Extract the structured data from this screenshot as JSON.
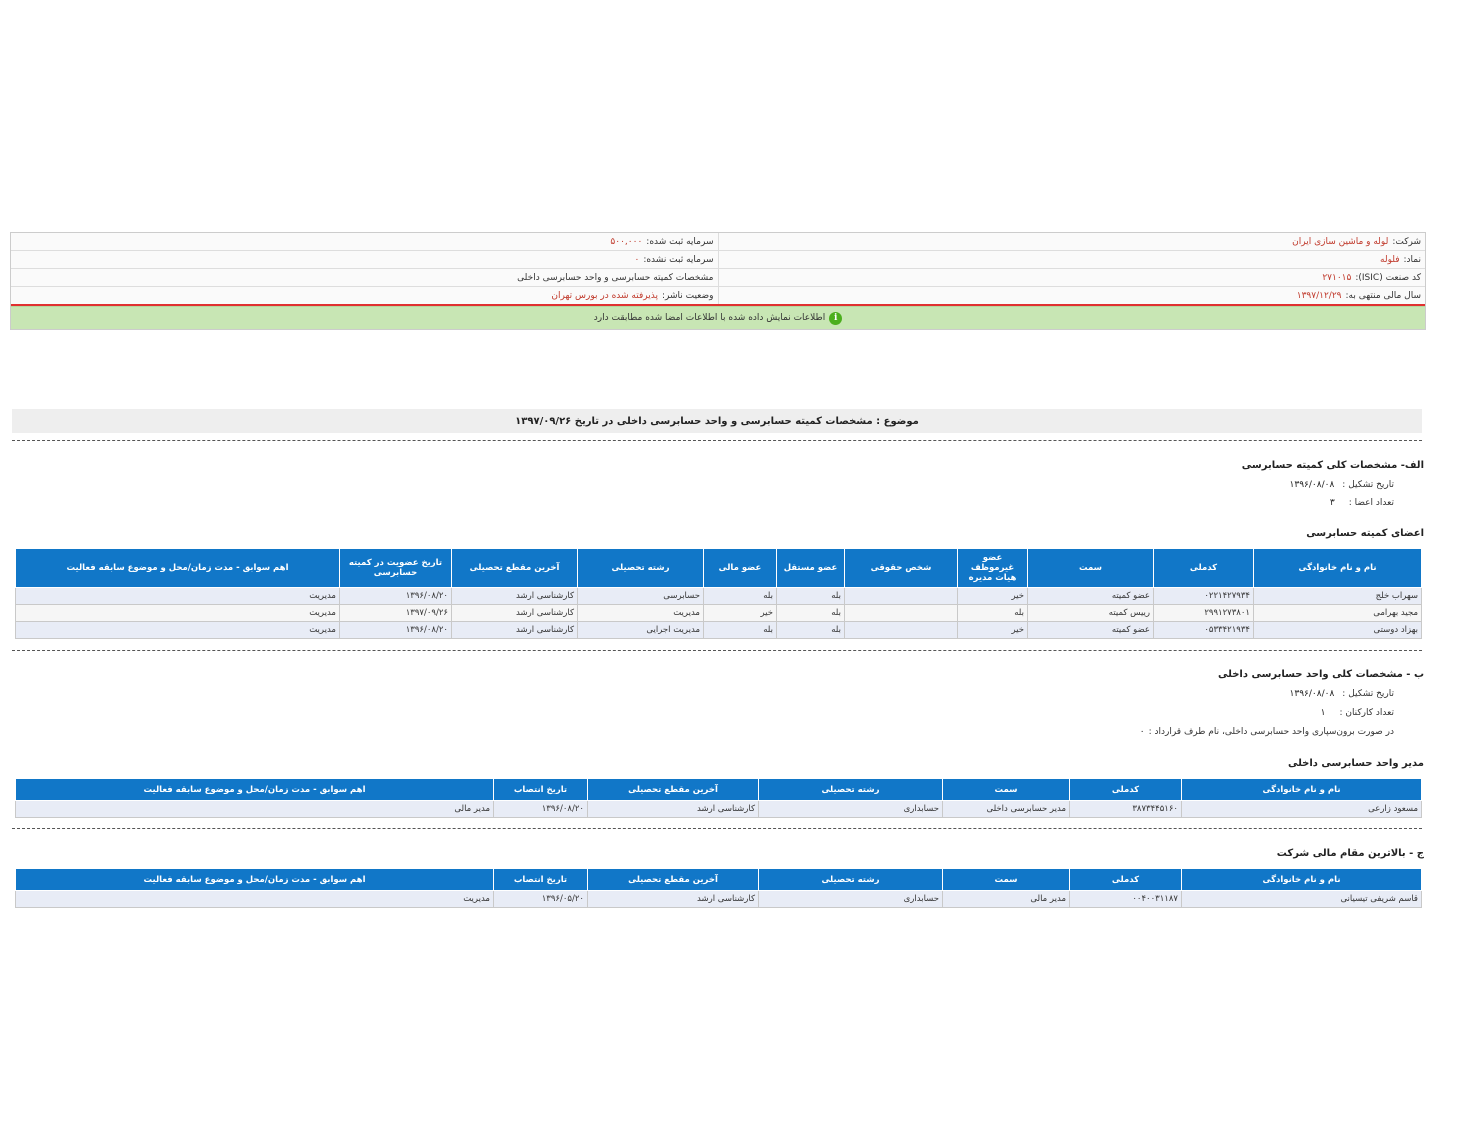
{
  "info": {
    "company_label": "شرکت:",
    "company_value": "لوله و ماشین سازی ایران",
    "symbol_label": "نماد:",
    "symbol_value": "فلوله",
    "isic_label": "کد صنعت (ISIC):",
    "isic_value": "۲۷۱۰۱۵",
    "fiscal_label": "سال مالی منتهی به:",
    "fiscal_value": "۱۳۹۷/۱۲/۲۹",
    "reg_capital_label": "سرمایه ثبت شده:",
    "reg_capital_value": "۵۰۰,۰۰۰",
    "unreg_capital_label": "سرمایه ثبت نشده:",
    "unreg_capital_value": "۰",
    "report_title": "مشخصات کمیته حسابرسی و واحد حسابرسی داخلی",
    "status_label": "وضعیت ناشر:",
    "status_value": "پذیرفته شده در بورس تهران",
    "notice": "اطلاعات نمایش داده شده با اطلاعات امضا شده مطابقت دارد",
    "notice_icon": "i"
  },
  "subject": "موضوع : مشخصات کمیته حسابرسی و واحد حسابرسی داخلی در تاریخ ۱۳۹۷/۰۹/۲۶",
  "section_a": {
    "title": "الف- مشخصات کلی کمیته حسابرسی",
    "formation_label": "تاریخ تشکیل :",
    "formation_value": "۱۳۹۶/۰۸/۰۸",
    "members_label": "تعداد اعضا :",
    "members_value": "۳"
  },
  "committee": {
    "title": "اعضای کمیته حسابرسی",
    "headers": [
      "نام و نام خانوادگی",
      "کدملی",
      "سمت",
      "عضو غیرموظف هیات مدیره",
      "شخص حقوقی",
      "عضو مستقل",
      "عضو مالی",
      "رشته تحصیلی",
      "آخرین مقطع تحصیلی",
      "تاریخ عضویت در کمیته حسابرسی",
      "اهم سوابق - مدت زمان/محل و موضوع سابقه فعالیت"
    ],
    "rows": [
      [
        "سهراب خلج",
        "۰۲۲۱۴۲۷۹۳۴",
        "عضو کمیته",
        "خیر",
        "",
        "بله",
        "بله",
        "حسابرسی",
        "کارشناسی ارشد",
        "۱۳۹۶/۰۸/۲۰",
        "مدیریت"
      ],
      [
        "مجید بهرامی",
        "۲۹۹۱۲۷۳۸۰۱",
        "رییس کمیته",
        "بله",
        "",
        "بله",
        "خیر",
        "مدیریت",
        "کارشناسی ارشد",
        "۱۳۹۷/۰۹/۲۶",
        "مدیریت"
      ],
      [
        "بهزاد دوستی",
        "۰۵۳۳۴۲۱۹۳۴",
        "عضو کمیته",
        "خیر",
        "",
        "بله",
        "بله",
        "مدیریت اجرایی",
        "کارشناسی ارشد",
        "۱۳۹۶/۰۸/۲۰",
        "مدیریت"
      ]
    ]
  },
  "section_b": {
    "title": "ب - مشخصات کلی واحد حسابرسی داخلی",
    "formation_label": "تاریخ تشکیل :",
    "formation_value": "۱۳۹۶/۰۸/۰۸",
    "staff_label": "تعداد کارکنان :",
    "staff_value": "۱",
    "outsource_label": "در صورت برون‌سپاری واحد حسابرسی داخلی، نام طرف قرارداد :",
    "outsource_value": "۰"
  },
  "audit_manager": {
    "title": "مدیر واحد حسابرسی داخلی",
    "headers": [
      "نام و نام خانوادگی",
      "کدملی",
      "سمت",
      "رشته تحصیلی",
      "آخرین مقطع تحصیلی",
      "تاریخ انتصاب",
      "اهم سوابق - مدت زمان/محل و موضوع سابقه فعالیت"
    ],
    "rows": [
      [
        "مسعود زارعی",
        "۳۸۷۳۴۴۵۱۶۰",
        "مدیر حسابرسی داخلی",
        "حسابداری",
        "کارشناسی ارشد",
        "۱۳۹۶/۰۸/۲۰",
        "مدیر مالی"
      ]
    ]
  },
  "section_c": {
    "title": "ج - بالاترین مقام مالی شرکت"
  },
  "cfo": {
    "headers": [
      "نام و نام خانوادگی",
      "کدملی",
      "سمت",
      "رشته تحصیلی",
      "آخرین مقطع تحصیلی",
      "تاریخ انتصاب",
      "اهم سوابق - مدت زمان/محل و موضوع سابقه فعالیت"
    ],
    "rows": [
      [
        "قاسم شریفی تیسیانی",
        "۰۰۴۰۰۳۱۱۸۷",
        "مدیر مالی",
        "حسابداری",
        "کارشناسی ارشد",
        "۱۳۹۶/۰۵/۲۰",
        "مدیریت"
      ]
    ]
  },
  "colors": {
    "header_blue": "#1177c8",
    "notice_green": "#c8e6b4",
    "value_red": "#c0392b",
    "divider_red": "#e03030"
  }
}
